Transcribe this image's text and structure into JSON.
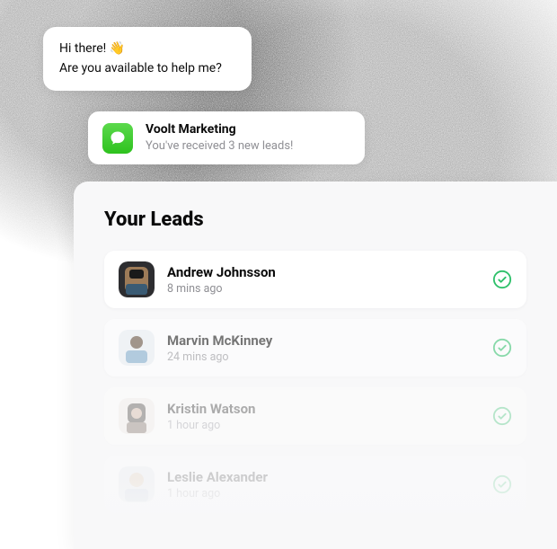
{
  "chat": {
    "line1": "Hi there! 👋",
    "line2": "Are you available to help me?"
  },
  "notification": {
    "app_name": "Voolt Marketing",
    "message": "You've received 3 new leads!",
    "icon_bg": "#2ec21e"
  },
  "panel": {
    "title": "Your Leads"
  },
  "leads": [
    {
      "name": "Andrew Johnsson",
      "time": "8 mins ago",
      "status": "done"
    },
    {
      "name": "Marvin McKinney",
      "time": "24 mins ago",
      "status": "done"
    },
    {
      "name": "Kristin Watson",
      "time": "1 hour ago",
      "status": "done"
    },
    {
      "name": "Leslie Alexander",
      "time": "1 hour ago",
      "status": "done"
    }
  ],
  "colors": {
    "check": "#2ec06a"
  }
}
